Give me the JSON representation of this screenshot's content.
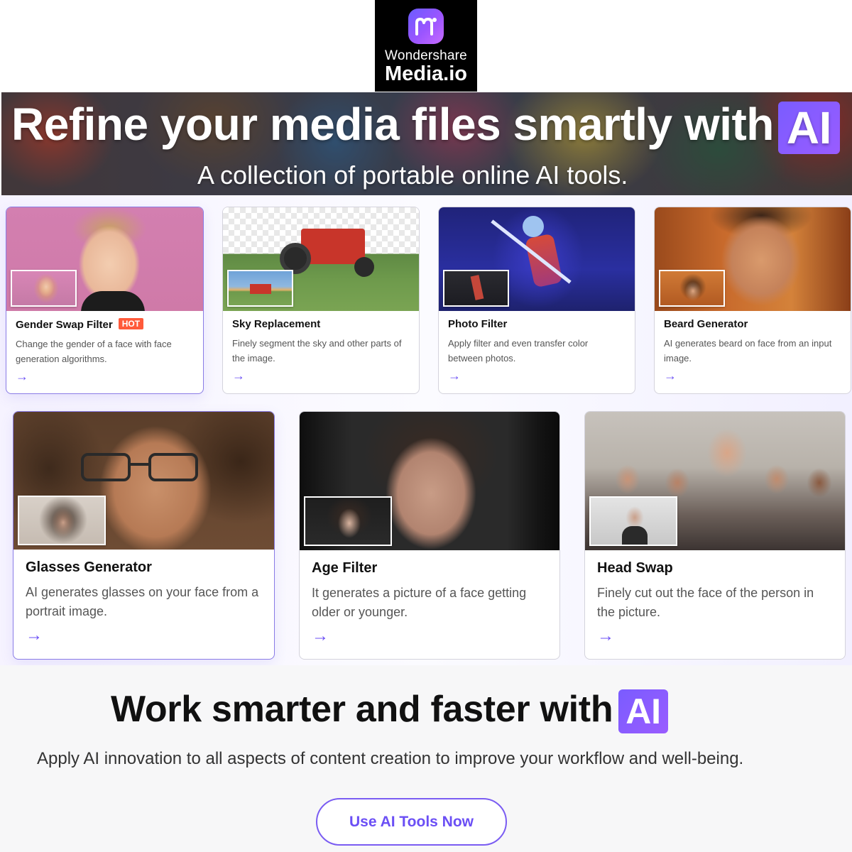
{
  "brand": {
    "line1": "Wondershare",
    "line2": "Media.io",
    "logo_icon": "media-io-logo-icon",
    "accent": "#7a5cff"
  },
  "hero": {
    "title": "Refine your media files smartly with",
    "badge": "AI",
    "subtitle": "A collection of portable online AI tools."
  },
  "tools": [
    {
      "title": "Gender Swap Filter",
      "badge": "HOT",
      "desc": "Change the gender of a face with face generation algorithms.",
      "arrow": "→"
    },
    {
      "title": "Sky Replacement",
      "desc": "Finely segment the sky and other parts of the image.",
      "arrow": "→"
    },
    {
      "title": "Photo Filter",
      "desc": "Apply filter and even transfer color between photos.",
      "arrow": "→"
    },
    {
      "title": "Beard Generator",
      "desc": "AI generates beard on face from an input image.",
      "arrow": "→"
    },
    {
      "title": "Glasses Generator",
      "desc": "AI generates glasses on your face from a portrait image.",
      "arrow": "→"
    },
    {
      "title": "Age Filter",
      "desc": "It generates a picture of a face getting older or younger.",
      "arrow": "→"
    },
    {
      "title": "Head Swap",
      "desc": "Finely cut out the face of the person in the picture.",
      "arrow": "→"
    }
  ],
  "cta": {
    "title": "Work smarter and faster with",
    "badge": "AI",
    "subtitle": "Apply AI innovation to all aspects of content creation to improve your workflow and well-being.",
    "button": "Use AI Tools Now"
  },
  "colors": {
    "accent": "#6b4ff5",
    "hot_badge": "#ff5a3a",
    "card_border": "#d4d3dc"
  }
}
